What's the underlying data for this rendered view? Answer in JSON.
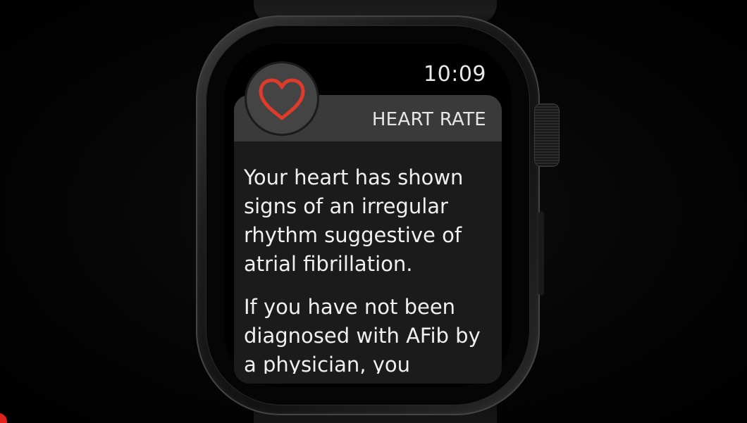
{
  "status": {
    "time": "10:09"
  },
  "notification": {
    "app_title": "HEART RATE",
    "app_icon": "heart-outline-icon",
    "paragraphs": [
      "Your heart has shown signs of an irregular rhythm suggestive of atrial fibrillation.",
      "If you have not been diagnosed with AFib by a physician, you"
    ]
  },
  "colors": {
    "heart_accent": "#e03a2a",
    "header_bg": "#3a3a3a",
    "card_bg": "#1b1b1b",
    "text": "#f0f0f0"
  }
}
